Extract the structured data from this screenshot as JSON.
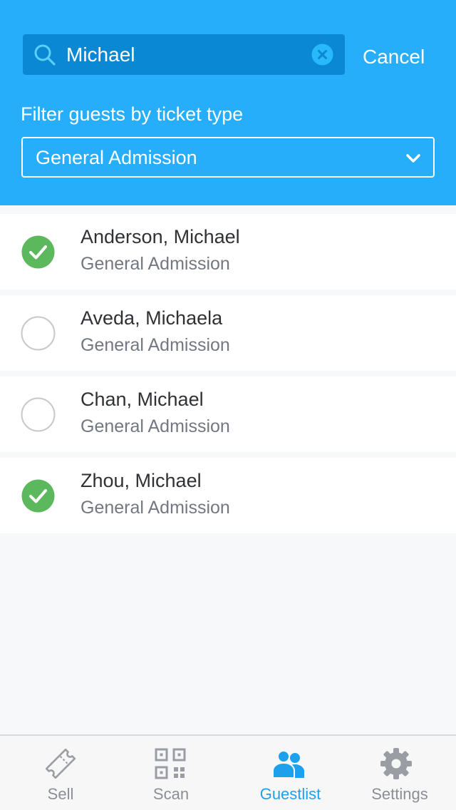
{
  "search": {
    "query": "Michael",
    "cancel_label": "Cancel"
  },
  "filter": {
    "label": "Filter guests by ticket type",
    "selected": "General Admission"
  },
  "guests": [
    {
      "name": "Anderson, Michael",
      "ticket_type": "General Admission",
      "checked_in": true
    },
    {
      "name": "Aveda, Michaela",
      "ticket_type": "General Admission",
      "checked_in": false
    },
    {
      "name": "Chan, Michael",
      "ticket_type": "General Admission",
      "checked_in": false
    },
    {
      "name": "Zhou, Michael",
      "ticket_type": "General Admission",
      "checked_in": true
    }
  ],
  "tabs": [
    {
      "label": "Sell",
      "icon": "ticket-icon",
      "active": false
    },
    {
      "label": "Scan",
      "icon": "qr-code-icon",
      "active": false
    },
    {
      "label": "Guestlist",
      "icon": "users-icon",
      "active": true
    },
    {
      "label": "Settings",
      "icon": "gear-icon",
      "active": false
    }
  ],
  "colors": {
    "header_bg": "#27aefb",
    "search_bg": "#0a88d4",
    "checked_green": "#5cb85c",
    "active_tab": "#1ea1ec",
    "inactive_tab": "#8b8f95"
  }
}
